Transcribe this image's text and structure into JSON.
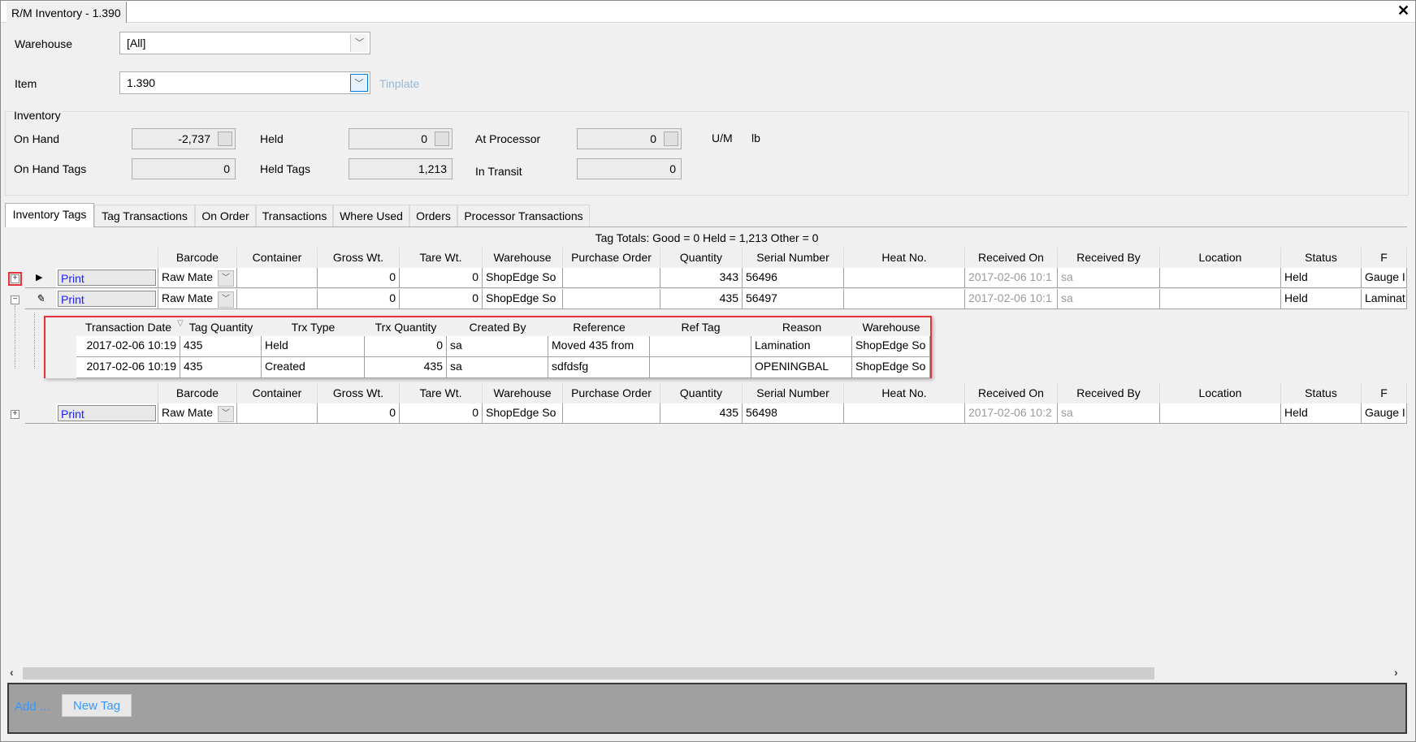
{
  "window": {
    "title": "R/M Inventory - 1.390",
    "close_icon": "close-icon"
  },
  "filters": {
    "warehouse_label": "Warehouse",
    "warehouse_value": "[All]",
    "item_label": "Item",
    "item_value": "1.390",
    "item_description": "Tinplate"
  },
  "inventory": {
    "group_label": "Inventory",
    "on_hand_label": "On Hand",
    "on_hand": "-2,737",
    "held_label": "Held",
    "held": "0",
    "at_processor_label": "At Processor",
    "at_processor": "0",
    "um_label": "U/M",
    "um": "lb",
    "on_hand_tags_label": "On Hand Tags",
    "on_hand_tags": "0",
    "held_tags_label": "Held Tags",
    "held_tags": "1,213",
    "in_transit_label": "In Transit",
    "in_transit": "0"
  },
  "tabs": [
    "Inventory Tags",
    "Tag Transactions",
    "On Order",
    "Transactions",
    "Where Used",
    "Orders",
    "Processor Transactions"
  ],
  "active_tab": "Inventory Tags",
  "grid": {
    "tag_totals": "Tag Totals:  Good = 0 Held = 1,213 Other = 0",
    "columns": [
      "",
      "Barcode",
      "Container",
      "Gross Wt.",
      "Tare Wt.",
      "Warehouse",
      "Purchase Order",
      "Quantity",
      "Serial Number",
      "Heat No.",
      "Received On",
      "Received By",
      "Location",
      "Status",
      "F"
    ],
    "rows": [
      {
        "print": "Print",
        "barcode": "Raw Mate",
        "container": "",
        "gross": "0",
        "tare": "0",
        "warehouse": "ShopEdge So",
        "po": "",
        "quantity": "343",
        "serial": "56496",
        "heat": "",
        "received_on": "2017-02-06 10:1",
        "received_by": "sa",
        "location": "",
        "status": "Held",
        "f": "Gauge I"
      },
      {
        "print": "Print",
        "barcode": "Raw Mate",
        "container": "",
        "gross": "0",
        "tare": "0",
        "warehouse": "ShopEdge So",
        "po": "",
        "quantity": "435",
        "serial": "56497",
        "heat": "",
        "received_on": "2017-02-06 10:1",
        "received_by": "sa",
        "location": "",
        "status": "Held",
        "f": "Laminat"
      },
      {
        "print": "Print",
        "barcode": "Raw Mate",
        "container": "",
        "gross": "0",
        "tare": "0",
        "warehouse": "ShopEdge So",
        "po": "",
        "quantity": "435",
        "serial": "56498",
        "heat": "",
        "received_on": "2017-02-06 10:2",
        "received_by": "sa",
        "location": "",
        "status": "Held",
        "f": "Gauge I"
      }
    ],
    "detail": {
      "columns": [
        "Transaction Date",
        "Tag Quantity",
        "Trx Type",
        "Trx Quantity",
        "Created By",
        "Reference",
        "Ref Tag",
        "Reason",
        "Warehouse"
      ],
      "rows": [
        [
          "2017-02-06 10:19",
          "435",
          "Held",
          "0",
          "sa",
          "Moved 435 from",
          "",
          "Lamination",
          "ShopEdge So"
        ],
        [
          "2017-02-06 10:19",
          "435",
          "Created",
          "435",
          "sa",
          "sdfdsfg",
          "",
          "OPENINGBAL",
          "ShopEdge So"
        ]
      ]
    }
  },
  "footer": {
    "add_label": "Add ...",
    "new_tag_label": "New Tag"
  },
  "colors": {
    "highlight": "#e8313a",
    "link": "#2020ff",
    "footer_bg": "#a0a0a0"
  }
}
